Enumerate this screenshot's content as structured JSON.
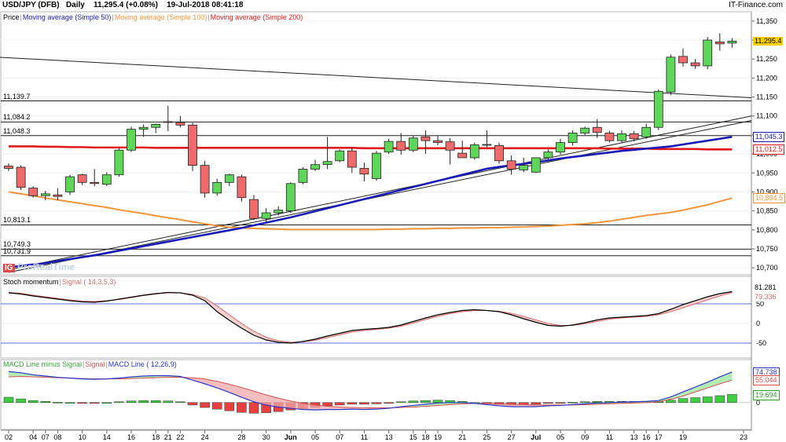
{
  "header": {
    "symbol": "USD/JPY (DFB)",
    "timeframe": "Daily",
    "last": "11,295.4 (+0.08%)",
    "datetime": "19-Jul-2018 08:41:18",
    "provider": "IT-Finance.com"
  },
  "watermark": {
    "brand": "IG",
    "text": "ProRealTime"
  },
  "price_legend": {
    "label": "Price",
    "ma50": "Moving average (Simple 50)",
    "ma100": "Moving average (Simple 100)",
    "ma200": "Moving average (Simple 200)"
  },
  "stoch_legend": {
    "label": "Stoch momentum",
    "signal": "Signal ( 14,3,5,3)"
  },
  "macd_legend": {
    "hist": "MACD Line minus Signal",
    "signal": "Signal",
    "line": "MACD Line ( 12,26,9)"
  },
  "price_axis_labels": [
    "11,350",
    "11,300",
    "11,250",
    "11,200",
    "11,150",
    "11,100",
    "11,050",
    "11,000",
    "10,950",
    "10,900",
    "10,850",
    "10,800",
    "10,750",
    "10,700"
  ],
  "stoch_axis_labels": [
    "50",
    "0",
    "-50"
  ],
  "macd_axis_labels": [
    "50",
    "0"
  ],
  "value_tags": {
    "last": "11,295.4",
    "ma50": "11,045.3",
    "ma200": "11,012.5",
    "ma100": "10,884.5",
    "stoch": "81.281",
    "stoch_signal": "79.336",
    "macd_line": "74.738",
    "macd_signal": "55.044",
    "macd_hist": "19.694"
  },
  "levels": [
    "11,139.7",
    "11,084.2",
    "11,048.3",
    "10,813.1",
    "10,749.3",
    "10,731.9"
  ],
  "x_labels": [
    "02",
    "04",
    "07",
    "08",
    "10",
    "14",
    "16",
    "18",
    "21",
    "22",
    "24",
    "28",
    "30",
    "Jun",
    "05",
    "07",
    "11",
    "13",
    "15",
    "18",
    "19",
    "21",
    "25",
    "27",
    "Jul",
    "05",
    "09",
    "11",
    "13",
    "16",
    "17",
    "19",
    "23"
  ],
  "chart_data": [
    {
      "type": "candlestick",
      "title": "USD/JPY (DFB)",
      "ylim": [
        10690,
        11360
      ],
      "levels": [
        11139.7,
        11084.2,
        11048.3,
        10813.1,
        10749.3,
        10731.9
      ],
      "ohlc": [
        [
          10968,
          10975,
          10955,
          10962
        ],
        [
          10965,
          10970,
          10905,
          10912
        ],
        [
          10910,
          10915,
          10885,
          10890
        ],
        [
          10890,
          10903,
          10878,
          10895
        ],
        [
          10892,
          10910,
          10878,
          10888
        ],
        [
          10900,
          10945,
          10892,
          10940
        ],
        [
          10945,
          10948,
          10918,
          10925
        ],
        [
          10925,
          10960,
          10915,
          10922
        ],
        [
          10920,
          10952,
          10915,
          10945
        ],
        [
          10945,
          11015,
          10940,
          11010
        ],
        [
          11010,
          11072,
          11005,
          11065
        ],
        [
          11065,
          11078,
          11045,
          11070
        ],
        [
          11070,
          11080,
          11055,
          11078
        ],
        [
          11085,
          11127,
          11060,
          11083
        ],
        [
          11083,
          11100,
          11070,
          11076
        ],
        [
          11076,
          11082,
          10955,
          10970
        ],
        [
          10970,
          10982,
          10885,
          10897
        ],
        [
          10897,
          10935,
          10890,
          10925
        ],
        [
          10925,
          10948,
          10915,
          10945
        ],
        [
          10940,
          10946,
          10875,
          10885
        ],
        [
          10880,
          10892,
          10826,
          10830
        ],
        [
          10830,
          10857,
          10820,
          10845
        ],
        [
          10845,
          10862,
          10838,
          10852
        ],
        [
          10850,
          10925,
          10845,
          10922
        ],
        [
          10925,
          10965,
          10920,
          10960
        ],
        [
          10960,
          10985,
          10955,
          10972
        ],
        [
          10972,
          11045,
          10960,
          10980
        ],
        [
          10982,
          11012,
          10978,
          11008
        ],
        [
          11008,
          11018,
          10950,
          10965
        ],
        [
          10962,
          10977,
          10928,
          10947
        ],
        [
          10935,
          11008,
          10930,
          11002
        ],
        [
          11005,
          11040,
          11000,
          11033
        ],
        [
          11033,
          11055,
          10998,
          11010
        ],
        [
          11010,
          11048,
          11005,
          11042
        ],
        [
          11045,
          11062,
          11000,
          11035
        ],
        [
          11035,
          11048,
          11023,
          11030
        ],
        [
          11032,
          11042,
          10972,
          11010
        ],
        [
          11002,
          11035,
          10990,
          10990
        ],
        [
          10990,
          11030,
          10985,
          11024
        ],
        [
          11024,
          11062,
          11018,
          11025
        ],
        [
          11022,
          11030,
          10974,
          10982
        ],
        [
          10982,
          10996,
          10945,
          10960
        ],
        [
          10958,
          10990,
          10952,
          10970
        ],
        [
          10952,
          10988,
          10950,
          10990
        ],
        [
          10990,
          11012,
          10985,
          11005
        ],
        [
          11005,
          11040,
          10998,
          11030
        ],
        [
          11030,
          11062,
          11022,
          11055
        ],
        [
          11055,
          11072,
          11050,
          11068
        ],
        [
          11070,
          11092,
          11042,
          11057
        ],
        [
          11055,
          11061,
          11030,
          11035
        ],
        [
          11035,
          11062,
          11028,
          11053
        ],
        [
          11053,
          11060,
          11033,
          11040
        ],
        [
          11045,
          11080,
          11040,
          11070
        ],
        [
          11070,
          11170,
          11063,
          11165
        ],
        [
          11163,
          11262,
          11156,
          11255
        ],
        [
          11257,
          11278,
          11230,
          11240
        ],
        [
          11240,
          11250,
          11224,
          11232
        ],
        [
          11232,
          11308,
          11223,
          11300
        ],
        [
          11295,
          11318,
          11272,
          11290
        ],
        [
          11292,
          11305,
          11280,
          11297
        ]
      ],
      "series": [
        {
          "name": "Moving average (Simple 50)",
          "values": [
            10702,
            10705,
            10709,
            10712,
            10718,
            10723,
            10728,
            10733,
            10739,
            10745,
            10751,
            10757,
            10763,
            10769,
            10775,
            10781,
            10787,
            10793,
            10799,
            10805,
            10812,
            10819,
            10826,
            10833,
            10841,
            10849,
            10857,
            10865,
            10873,
            10881,
            10889,
            10897,
            10905,
            10913,
            10921,
            10929,
            10937,
            10945,
            10953,
            10961,
            10966,
            10970,
            10974,
            10978,
            10983,
            10988,
            10992,
            10996,
            11000,
            11004,
            11008,
            11011,
            11014,
            11017,
            11020,
            11025,
            11030,
            11035,
            11040,
            11045
          ]
        },
        {
          "name": "Moving average (Simple 100)",
          "values": [
            10900,
            10895,
            10890,
            10884,
            10879,
            10874,
            10869,
            10864,
            10859,
            10853,
            10848,
            10843,
            10837,
            10832,
            10827,
            10821,
            10816,
            10811,
            10807,
            10805,
            10804,
            10803,
            10802,
            10801,
            10801,
            10801,
            10801,
            10801,
            10801,
            10801,
            10801,
            10802,
            10802,
            10803,
            10803,
            10804,
            10804,
            10805,
            10805,
            10806,
            10806,
            10807,
            10808,
            10809,
            10810,
            10812,
            10814,
            10816,
            10819,
            10823,
            10828,
            10833,
            10838,
            10842,
            10846,
            10852,
            10859,
            10866,
            10875,
            10884
          ]
        },
        {
          "name": "Moving average (Simple 200)",
          "values": [
            11020,
            11020,
            11020,
            11019,
            11019,
            11018,
            11018,
            11017,
            11017,
            11017,
            11017,
            11017,
            11016,
            11016,
            11016,
            11016,
            11016,
            11016,
            11016,
            11016,
            11016,
            11016,
            11016,
            11016,
            11016,
            11016,
            11016,
            11016,
            11016,
            11015,
            11015,
            11015,
            11015,
            11015,
            11015,
            11015,
            11015,
            11015,
            11015,
            11015,
            11015,
            11015,
            11015,
            11015,
            11015,
            11015,
            11015,
            11015,
            11015,
            11014,
            11014,
            11014,
            11014,
            11013,
            11013,
            11013,
            11013,
            11012,
            11012,
            11012
          ]
        }
      ]
    },
    {
      "type": "line",
      "title": "Stoch momentum",
      "ylim": [
        -80,
        100
      ],
      "series": [
        {
          "name": "Stoch momentum",
          "values": [
            78,
            75,
            70,
            66,
            62,
            58,
            55,
            54,
            57,
            62,
            67,
            72,
            76,
            79,
            78,
            72,
            58,
            30,
            8,
            -12,
            -30,
            -42,
            -48,
            -50,
            -46,
            -40,
            -32,
            -25,
            -18,
            -15,
            -13,
            -10,
            -4,
            5,
            14,
            22,
            28,
            33,
            35,
            33,
            30,
            22,
            12,
            3,
            -5,
            -7,
            -4,
            2,
            9,
            14,
            16,
            18,
            20,
            25,
            36,
            48,
            58,
            68,
            76,
            81
          ]
        },
        {
          "name": "Signal ( 14,3,5,3)",
          "values": [
            79,
            77,
            72,
            68,
            64,
            60,
            57,
            56,
            58,
            61,
            66,
            71,
            75,
            78,
            78,
            74,
            65,
            45,
            22,
            0,
            -20,
            -35,
            -44,
            -48,
            -47,
            -43,
            -36,
            -29,
            -22,
            -18,
            -15,
            -12,
            -7,
            1,
            10,
            18,
            25,
            30,
            33,
            33,
            31,
            26,
            18,
            9,
            0,
            -5,
            -5,
            -1,
            5,
            11,
            14,
            16,
            18,
            22,
            30,
            40,
            50,
            60,
            70,
            79
          ]
        }
      ]
    },
    {
      "type": "bar",
      "title": "MACD Line ( 12,26,9)",
      "ylim": [
        -60,
        90
      ],
      "series": [
        {
          "name": "MACD Line minus Signal",
          "values": [
            13,
            9,
            5,
            3,
            1,
            0,
            -1,
            -1,
            0,
            2,
            4,
            5,
            5,
            4,
            2,
            -6,
            -12,
            -16,
            -20,
            -24,
            -26,
            -25,
            -22,
            -18,
            -15,
            -12,
            -8,
            -6,
            -4,
            -4,
            -3,
            -1,
            2,
            4,
            5,
            6,
            5,
            3,
            0,
            -3,
            -5,
            -6,
            -5,
            -4,
            -2,
            -1,
            1,
            2,
            3,
            3,
            3,
            3,
            3,
            3,
            6,
            10,
            12,
            14,
            17,
            20
          ]
        },
        {
          "name": "Signal",
          "values": [
            63,
            64,
            63,
            62,
            61,
            60,
            59,
            58,
            58,
            58,
            59,
            60,
            61,
            62,
            62,
            61,
            58,
            52,
            45,
            37,
            28,
            19,
            11,
            4,
            -2,
            -6,
            -9,
            -11,
            -12,
            -13,
            -13,
            -13,
            -12,
            -11,
            -9,
            -7,
            -5,
            -3,
            -2,
            -2,
            -3,
            -4,
            -5,
            -6,
            -6,
            -6,
            -6,
            -5,
            -4,
            -3,
            -2,
            -1,
            0,
            2,
            8,
            16,
            26,
            36,
            46,
            55
          ]
        },
        {
          "name": "MACD Line",
          "values": [
            76,
            73,
            68,
            65,
            62,
            60,
            58,
            57,
            58,
            60,
            63,
            65,
            66,
            66,
            64,
            55,
            46,
            36,
            25,
            13,
            2,
            -6,
            -11,
            -14,
            -17,
            -18,
            -17,
            -17,
            -16,
            -17,
            -16,
            -14,
            -10,
            -7,
            -4,
            -1,
            0,
            0,
            -2,
            -5,
            -8,
            -10,
            -10,
            -10,
            -8,
            -7,
            -5,
            -3,
            -1,
            0,
            1,
            2,
            3,
            5,
            14,
            26,
            38,
            50,
            63,
            75
          ]
        }
      ]
    }
  ],
  "colors": {
    "up": "#5ed65a",
    "down": "#ef6a6a",
    "ma50": "#1a1ab8",
    "ma100": "#f2953a",
    "ma200": "#e01a1a",
    "last_tag": "#f8d000",
    "stoch": "#000000",
    "stoch_signal": "#d96b6b",
    "macd_line": "#2b37c8",
    "macd_signal": "#d65050"
  }
}
